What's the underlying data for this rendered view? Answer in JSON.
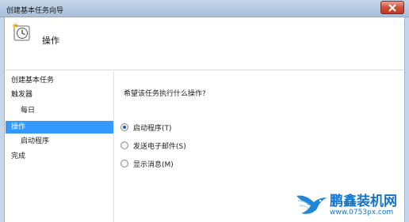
{
  "window": {
    "title": "创建基本任务向导"
  },
  "header": {
    "title": "操作"
  },
  "nav": {
    "items": [
      {
        "label": "创建基本任务",
        "selected": false
      },
      {
        "label": "触发器",
        "selected": false
      },
      {
        "label": "每日",
        "selected": false
      },
      {
        "label": "操作",
        "selected": true
      },
      {
        "label": "启动程序",
        "selected": false
      },
      {
        "label": "完成",
        "selected": false
      }
    ]
  },
  "content": {
    "question": "希望该任务执行什么操作?",
    "options": [
      {
        "label": "启动程序(T)",
        "checked": true
      },
      {
        "label": "发送电子邮件(S)",
        "checked": false
      },
      {
        "label": "显示消息(M)",
        "checked": false
      }
    ]
  },
  "watermark": {
    "brand": "鹏鑫装机网",
    "url": "www.0753px.com"
  },
  "colors": {
    "selection": "#3399ff",
    "titlebar": "#b7cbe2",
    "close_button": "#d0503a",
    "watermark": "#1473c9"
  }
}
